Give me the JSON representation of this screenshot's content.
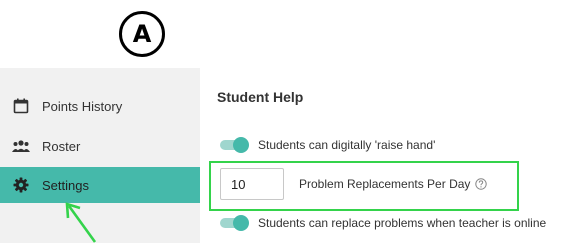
{
  "marker": {
    "letter": "A"
  },
  "sidebar": {
    "items": [
      {
        "label": "Points History",
        "icon": "calendar-icon",
        "active": false
      },
      {
        "label": "Roster",
        "icon": "people-icon",
        "active": false
      },
      {
        "label": "Settings",
        "icon": "gear-icon",
        "active": true
      }
    ]
  },
  "main": {
    "section_title": "Student Help",
    "raise_hand": {
      "label": "Students can digitally 'raise hand'",
      "enabled": true
    },
    "replacements": {
      "value": "10",
      "label": "Problem Replacements Per Day",
      "help_icon": "question-circle-icon"
    },
    "replace_problems": {
      "label": "Students can replace problems when teacher is online",
      "enabled": true
    }
  },
  "colors": {
    "accent": "#45b9aa",
    "highlight": "#34d34b",
    "sidebar_bg": "#f1f1f1"
  }
}
